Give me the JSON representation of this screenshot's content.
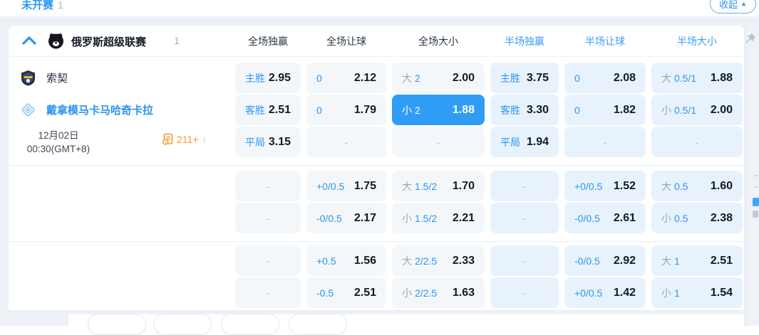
{
  "top_bar": {
    "status_tab": {
      "label": "未开赛",
      "count": "1"
    },
    "collapse_button": {
      "label": "收起",
      "icon": "collapse-up-triangle"
    }
  },
  "league_header": {
    "collapse_icon": "chevron-up-icon",
    "name": "俄罗斯超级联赛",
    "count": "1",
    "columns": [
      {
        "label": "全场独赢",
        "scope": "full"
      },
      {
        "label": "全场让球",
        "scope": "full"
      },
      {
        "label": "全场大小",
        "scope": "full"
      },
      {
        "label": "半场独赢",
        "scope": "half"
      },
      {
        "label": "半场让球",
        "scope": "half"
      },
      {
        "label": "半场大小",
        "scope": "half"
      }
    ],
    "pin_icon": "pushpin-icon"
  },
  "match": {
    "home_team": "索契",
    "away_team": "戴拿模马卡马哈奇卡拉",
    "date": "12月02日",
    "time": "00:30(GMT+8)",
    "more_markets": "211+",
    "more_markets_icon": "markets-list-icon"
  },
  "odds": {
    "blocks": [
      {
        "rows": [
          [
            {
              "label": "主胜",
              "odds": "2.95"
            },
            {
              "label": "0",
              "odds": "2.12"
            },
            {
              "prefix": "大",
              "label": "2",
              "odds": "2.00"
            },
            {
              "label": "主胜",
              "odds": "3.75",
              "half": true
            },
            {
              "label": "0",
              "odds": "2.08",
              "half": true
            },
            {
              "prefix": "大",
              "label": "0.5/1",
              "odds": "1.88",
              "half": true
            }
          ],
          [
            {
              "label": "客胜",
              "odds": "2.51"
            },
            {
              "label": "0",
              "odds": "1.79"
            },
            {
              "prefix": "小",
              "label": "2",
              "odds": "1.88",
              "selected": true
            },
            {
              "label": "客胜",
              "odds": "3.30",
              "half": true
            },
            {
              "label": "0",
              "odds": "1.82",
              "half": true
            },
            {
              "prefix": "小",
              "label": "0.5/1",
              "odds": "2.00",
              "half": true
            }
          ],
          [
            {
              "label": "平局",
              "odds": "3.15"
            },
            {
              "dash": true
            },
            {
              "dash": true
            },
            {
              "label": "平局",
              "odds": "1.94",
              "half": true
            },
            {
              "dash": true,
              "half": true
            },
            {
              "dash": true,
              "half": true
            }
          ]
        ]
      },
      {
        "rows": [
          [
            {
              "dash": true
            },
            {
              "label": "+0/0.5",
              "odds": "1.75"
            },
            {
              "prefix": "大",
              "label": "1.5/2",
              "odds": "1.70"
            },
            {
              "dash": true,
              "half": true
            },
            {
              "label": "+0/0.5",
              "odds": "1.52",
              "half": true
            },
            {
              "prefix": "大",
              "label": "0.5",
              "odds": "1.60",
              "half": true
            }
          ],
          [
            {
              "dash": true
            },
            {
              "label": "-0/0.5",
              "odds": "2.17"
            },
            {
              "prefix": "小",
              "label": "1.5/2",
              "odds": "2.21"
            },
            {
              "dash": true,
              "half": true
            },
            {
              "label": "-0/0.5",
              "odds": "2.61",
              "half": true
            },
            {
              "prefix": "小",
              "label": "0.5",
              "odds": "2.38",
              "half": true
            }
          ]
        ]
      },
      {
        "rows": [
          [
            {
              "dash": true
            },
            {
              "label": "+0.5",
              "odds": "1.56"
            },
            {
              "prefix": "大",
              "label": "2/2.5",
              "odds": "2.33"
            },
            {
              "dash": true,
              "half": true
            },
            {
              "label": "-0/0.5",
              "odds": "2.92",
              "half": true
            },
            {
              "prefix": "大",
              "label": "1",
              "odds": "2.51",
              "half": true
            }
          ],
          [
            {
              "dash": true
            },
            {
              "label": "-0.5",
              "odds": "2.51"
            },
            {
              "prefix": "小",
              "label": "2/2.5",
              "odds": "1.63"
            },
            {
              "dash": true,
              "half": true
            },
            {
              "label": "+0/0.5",
              "odds": "1.42",
              "half": true
            },
            {
              "prefix": "小",
              "label": "1",
              "odds": "1.54",
              "half": true
            }
          ]
        ]
      }
    ],
    "empty_symbol": "-"
  },
  "colors": {
    "accent_blue": "#2b95f0",
    "selected_cell": "#2f9df5",
    "cell_full_bg": "#f4f7fa",
    "cell_half_bg": "#e8f2fc",
    "orange": "#f59b2d"
  }
}
